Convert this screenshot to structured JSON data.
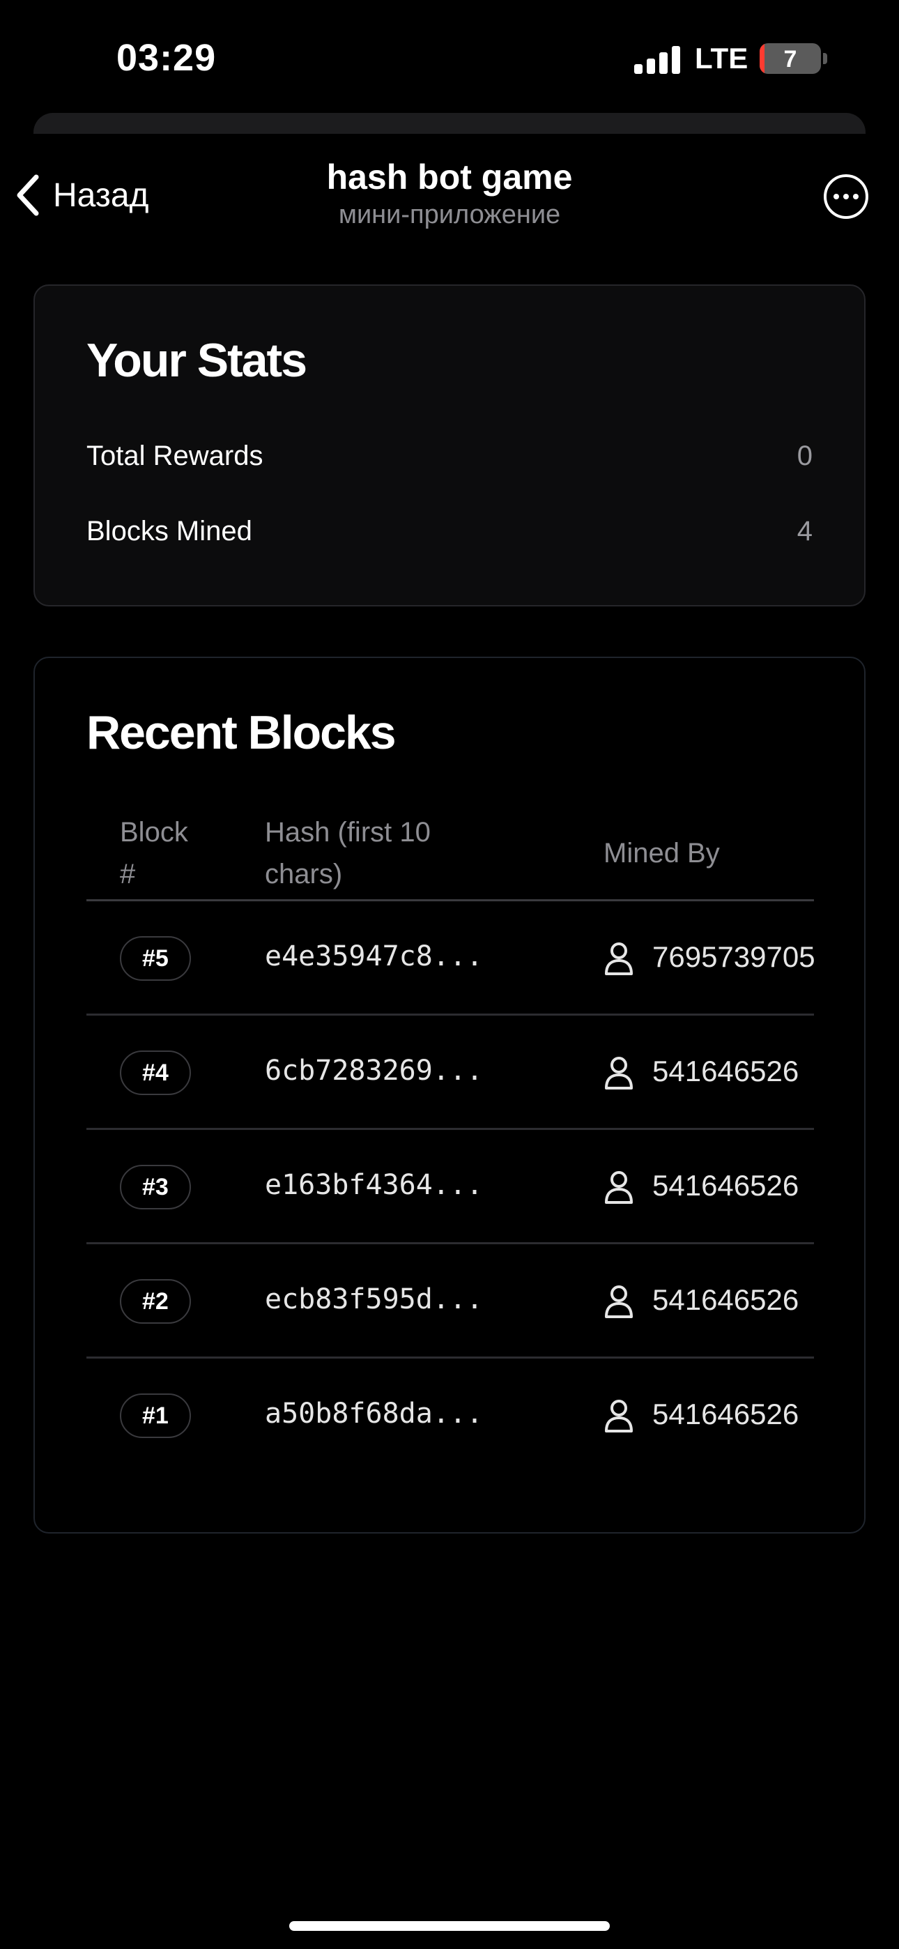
{
  "status_bar": {
    "time": "03:29",
    "network": "LTE",
    "battery": "7",
    "battery_color": "#ff3b30"
  },
  "nav": {
    "back_label": "Назад",
    "title": "hash bot game",
    "subtitle": "мини-приложение",
    "more_icon": "ellipsis-circle-icon"
  },
  "stats": {
    "title": "Your Stats",
    "rows": [
      {
        "label": "Total Rewards",
        "value": "0"
      },
      {
        "label": "Blocks Mined",
        "value": "4"
      }
    ]
  },
  "recent_blocks": {
    "title": "Recent Blocks",
    "columns": {
      "block_line1": "Block",
      "block_line2": "#",
      "hash_line1": "Hash (first 10",
      "hash_line2": "chars)",
      "miner": "Mined By"
    },
    "rows": [
      {
        "block": "#5",
        "hash": "e4e35947c8...",
        "miner": "7695739705"
      },
      {
        "block": "#4",
        "hash": "6cb7283269...",
        "miner": "541646526"
      },
      {
        "block": "#3",
        "hash": "e163bf4364...",
        "miner": "541646526"
      },
      {
        "block": "#2",
        "hash": "ecb83f595d...",
        "miner": "541646526"
      },
      {
        "block": "#1",
        "hash": "a50b8f68da...",
        "miner": "541646526"
      }
    ]
  }
}
